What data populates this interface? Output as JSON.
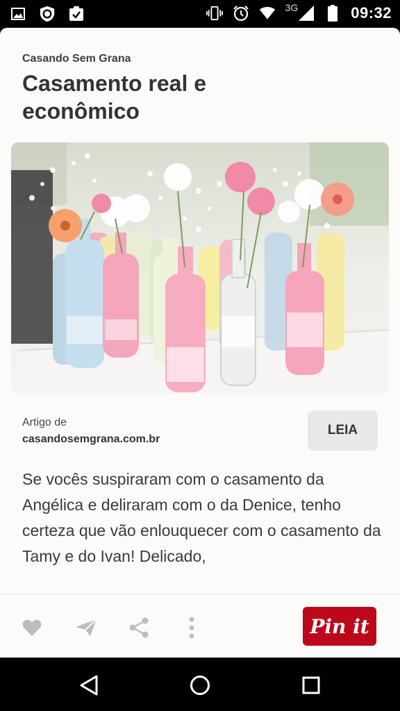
{
  "status_bar": {
    "time": "09:32",
    "network_type": "3G",
    "icons_left": [
      "image-icon",
      "shield-icon",
      "clipboard-check-icon"
    ],
    "icons_right": [
      "vibrate-icon",
      "alarm-icon",
      "wifi-icon",
      "signal-icon",
      "battery-icon"
    ]
  },
  "pin": {
    "source": "Casando Sem Grana",
    "title": "Casamento real e econômico",
    "image_icon": "photo-pastel-bottle-vases",
    "article_label": "Artigo de",
    "article_domain": "casandosemgrana.com.br",
    "read_button": "LEIA",
    "description": "Se vocês suspiraram com o casamento da Angélica e deliraram com o da Denice, tenho certeza que vão enlouquecer com o casamento da Tamy e do Ivan! Delicado,"
  },
  "actions": {
    "icons": [
      "heart-icon",
      "send-icon",
      "share-icon",
      "more-vertical-icon"
    ],
    "pin_button": "Pin it",
    "pin_color": "#bd081c"
  },
  "nav": {
    "icons": [
      "back-icon",
      "home-icon",
      "recents-icon"
    ]
  }
}
